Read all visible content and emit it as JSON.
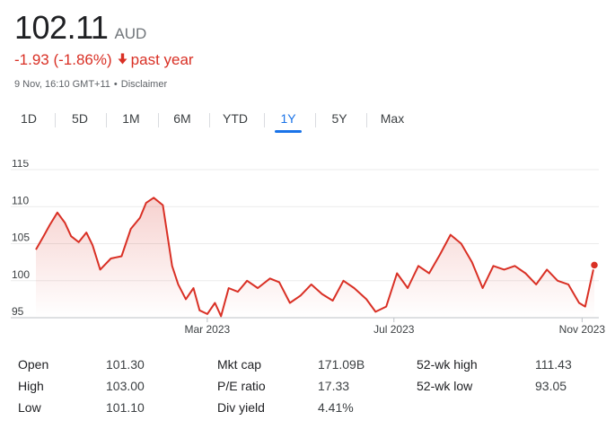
{
  "quote": {
    "price": "102.11",
    "currency": "AUD",
    "change": "-1.93 (-1.86%)",
    "change_period": "past year",
    "timestamp": "9 Nov, 16:10 GMT+11",
    "disclaimer": "Disclaimer",
    "change_color": "#d93025",
    "arrow_icon": "arrow-down-icon"
  },
  "tabs": [
    {
      "label": "1D"
    },
    {
      "label": "5D"
    },
    {
      "label": "1M"
    },
    {
      "label": "6M"
    },
    {
      "label": "YTD"
    },
    {
      "label": "1Y",
      "active": true
    },
    {
      "label": "5Y"
    },
    {
      "label": "Max"
    }
  ],
  "chart_data": {
    "type": "area",
    "title": "",
    "xlabel": "",
    "ylabel": "",
    "ylim": [
      95,
      115
    ],
    "yticks": [
      115,
      110,
      105,
      100,
      95
    ],
    "xtick_labels": [
      "Mar 2023",
      "Jul 2023",
      "Nov 2023"
    ],
    "grid": true,
    "line_color": "#d93025",
    "x": [
      "2022-11-09",
      "2022-11-14",
      "2022-11-18",
      "2022-11-23",
      "2022-11-28",
      "2022-12-02",
      "2022-12-07",
      "2022-12-12",
      "2022-12-16",
      "2022-12-21",
      "2022-12-28",
      "2023-01-04",
      "2023-01-10",
      "2023-01-16",
      "2023-01-20",
      "2023-01-25",
      "2023-01-31",
      "2023-02-06",
      "2023-02-10",
      "2023-02-15",
      "2023-02-20",
      "2023-02-24",
      "2023-03-01",
      "2023-03-06",
      "2023-03-10",
      "2023-03-15",
      "2023-03-21",
      "2023-03-27",
      "2023-04-03",
      "2023-04-11",
      "2023-04-17",
      "2023-04-24",
      "2023-05-01",
      "2023-05-08",
      "2023-05-15",
      "2023-05-22",
      "2023-05-29",
      "2023-06-05",
      "2023-06-13",
      "2023-06-19",
      "2023-06-26",
      "2023-07-03",
      "2023-07-10",
      "2023-07-17",
      "2023-07-24",
      "2023-07-31",
      "2023-08-07",
      "2023-08-14",
      "2023-08-21",
      "2023-08-28",
      "2023-09-04",
      "2023-09-11",
      "2023-09-18",
      "2023-09-25",
      "2023-10-02",
      "2023-10-09",
      "2023-10-16",
      "2023-10-23",
      "2023-10-30",
      "2023-11-03",
      "2023-11-09"
    ],
    "series": [
      {
        "values": [
          104.2,
          106.0,
          107.5,
          109.2,
          107.8,
          106.0,
          105.2,
          106.5,
          104.8,
          101.5,
          103.0,
          103.3,
          107.0,
          108.5,
          110.5,
          111.2,
          110.2,
          102.0,
          99.5,
          97.5,
          99.0,
          96.0,
          95.5,
          97.0,
          95.2,
          99.0,
          98.5,
          100.0,
          99.0,
          100.3,
          99.8,
          97.0,
          98.0,
          99.5,
          98.2,
          97.3,
          100.0,
          99.0,
          97.5,
          95.8,
          96.5,
          101.0,
          99.0,
          102.0,
          101.0,
          103.5,
          106.2,
          105.0,
          102.5,
          99.0,
          102.0,
          101.5,
          102.0,
          101.0,
          99.5,
          101.5,
          100.0,
          99.5,
          97.0,
          96.5,
          102.11
        ]
      }
    ]
  },
  "stats": {
    "open_label": "Open",
    "open_value": "101.30",
    "high_label": "High",
    "high_value": "103.00",
    "low_label": "Low",
    "low_value": "101.10",
    "mktcap_label": "Mkt cap",
    "mktcap_value": "171.09B",
    "pe_label": "P/E ratio",
    "pe_value": "17.33",
    "div_label": "Div yield",
    "div_value": "4.41%",
    "wkhigh_label": "52-wk high",
    "wkhigh_value": "111.43",
    "wklow_label": "52-wk low",
    "wklow_value": "93.05"
  }
}
